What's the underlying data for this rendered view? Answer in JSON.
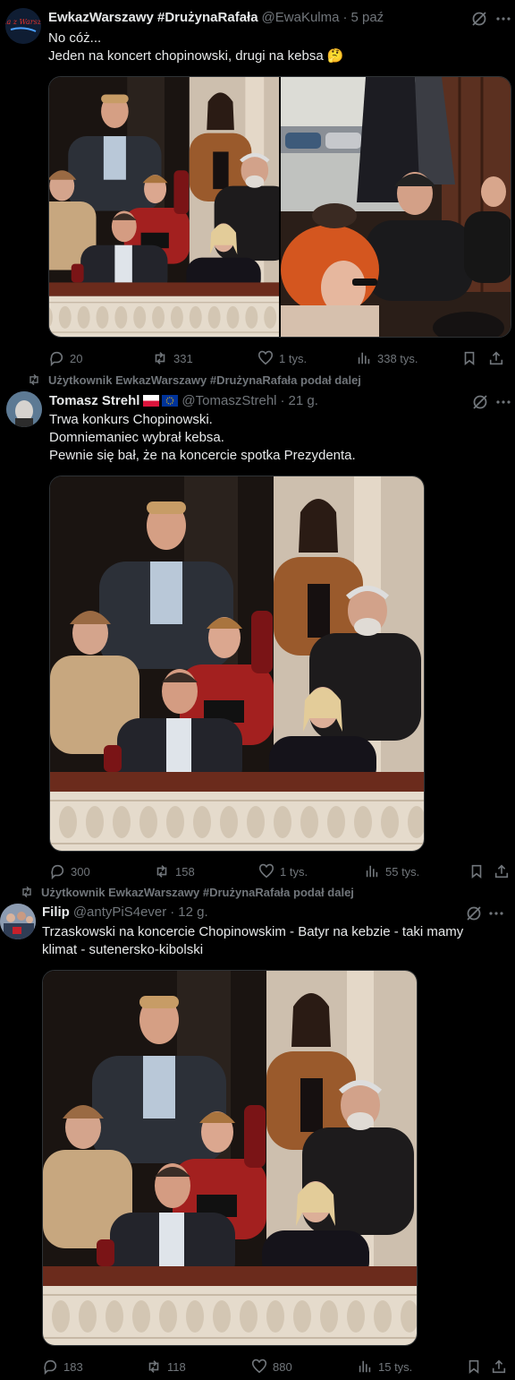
{
  "tweets": [
    {
      "author_name": "EwkazWarszawy #DrużynaRafała",
      "handle": "@EwaKulma",
      "time": "5 paź",
      "avatar_text": "Ewka z Warszawy",
      "text_lines": [
        "No cóż...",
        "Jeden na koncert chopinowski, drugi na kebsa 🤔"
      ],
      "stats": {
        "replies": "20",
        "reposts": "331",
        "likes": "1 tys.",
        "views": "338 tys."
      }
    },
    {
      "repost_label": "Użytkownik EwkazWarszawy #DrużynaRafała podał dalej",
      "author_name": "Tomasz Strehl",
      "flags": "🇵🇱 🇪🇺",
      "handle": "@TomaszStrehl",
      "time": "21 g.",
      "text_lines": [
        "Trwa konkurs Chopinowski.",
        "Domniemaniec wybrał kebsa.",
        "Pewnie się bał, że na koncercie spotka Prezydenta."
      ],
      "stats": {
        "replies": "300",
        "reposts": "158",
        "likes": "1 tys.",
        "views": "55 tys."
      }
    },
    {
      "repost_label": "Użytkownik EwkazWarszawy #DrużynaRafała podał dalej",
      "author_name": "Filip",
      "handle": "@antyPiS4ever",
      "time": "12 g.",
      "text_lines": [
        "Trzaskowski na koncercie Chopinowskim - Batyr na kebzie - taki mamy",
        "klimat -  sutenersko-kibolski"
      ],
      "stats": {
        "replies": "183",
        "reposts": "118",
        "likes": "880",
        "views": "15 tys."
      }
    }
  ],
  "separator": "·",
  "icons": [
    "grok-icon",
    "more-icon",
    "reply-icon",
    "repost-icon",
    "like-icon",
    "views-icon",
    "bookmark-icon",
    "share-icon"
  ]
}
